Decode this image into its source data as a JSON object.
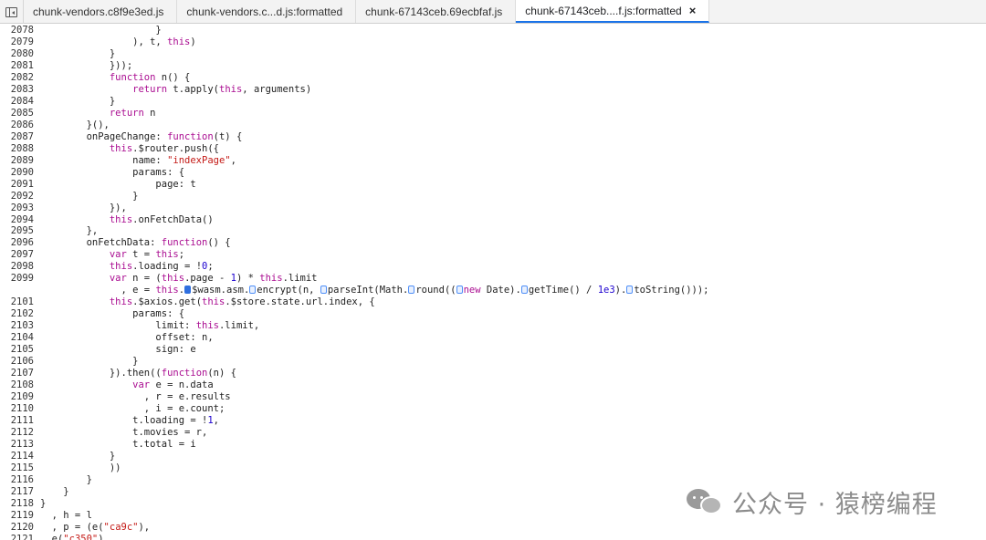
{
  "tabs": [
    {
      "label": "chunk-vendors.c8f9e3ed.js",
      "active": false
    },
    {
      "label": "chunk-vendors.c...d.js:formatted",
      "active": false
    },
    {
      "label": "chunk-67143ceb.69ecbfaf.js",
      "active": false
    },
    {
      "label": "chunk-67143ceb....f.js:formatted",
      "active": true
    }
  ],
  "close_glyph": "×",
  "current_line": "2100",
  "lines": [
    {
      "n": "2078",
      "html": "                    }"
    },
    {
      "n": "2079",
      "html": "                ), t, <span class='kw'>this</span>)"
    },
    {
      "n": "2080",
      "html": "            }"
    },
    {
      "n": "2081",
      "html": "            }));"
    },
    {
      "n": "2082",
      "html": "            <span class='kw'>function</span> n() {"
    },
    {
      "n": "2083",
      "html": "                <span class='kw'>return</span> t.apply(<span class='kw'>this</span>, arguments)"
    },
    {
      "n": "2084",
      "html": "            }"
    },
    {
      "n": "2085",
      "html": "            <span class='kw'>return</span> n"
    },
    {
      "n": "2086",
      "html": "        }(),"
    },
    {
      "n": "2087",
      "html": "        onPageChange: <span class='kw'>function</span>(t) {"
    },
    {
      "n": "2088",
      "html": "            <span class='kw'>this</span>.$router.push({"
    },
    {
      "n": "2089",
      "html": "                name: <span class='str'>\"indexPage\"</span>,"
    },
    {
      "n": "2090",
      "html": "                params: {"
    },
    {
      "n": "2091",
      "html": "                    page: t"
    },
    {
      "n": "2092",
      "html": "                }"
    },
    {
      "n": "2093",
      "html": "            }),"
    },
    {
      "n": "2094",
      "html": "            <span class='kw'>this</span>.onFetchData()"
    },
    {
      "n": "2095",
      "html": "        },"
    },
    {
      "n": "2096",
      "html": "        onFetchData: <span class='kw'>function</span>() {"
    },
    {
      "n": "2097",
      "html": "            <span class='kw'>var</span> t = <span class='kw'>this</span>;"
    },
    {
      "n": "2098",
      "html": "            <span class='kw'>this</span>.loading = !<span class='num'>0</span>;"
    },
    {
      "n": "2099",
      "html": "            <span class='kw'>var</span> n = (<span class='kw'>this</span>.page - <span class='num'>1</span>) * <span class='kw'>this</span>.limit"
    },
    {
      "n": "2100",
      "html": "              , e = <span class='kw'>this</span>.<span class='mark filled'></span>$wasm.asm.<span class='mark'></span>encrypt(n, <span class='mark'></span>parseInt(Math.<span class='mark'></span>round((<span class='mark'></span><span class='kw'>new</span> Date).<span class='mark'></span>getTime() / <span class='num'>1e3</span>).<span class='mark'></span>toString()));"
    },
    {
      "n": "2101",
      "html": "            <span class='kw'>this</span>.$axios.get(<span class='kw'>this</span>.$store.state.url.index, {"
    },
    {
      "n": "2102",
      "html": "                params: {"
    },
    {
      "n": "2103",
      "html": "                    limit: <span class='kw'>this</span>.limit,"
    },
    {
      "n": "2104",
      "html": "                    offset: n,"
    },
    {
      "n": "2105",
      "html": "                    sign: e"
    },
    {
      "n": "2106",
      "html": "                }"
    },
    {
      "n": "2107",
      "html": "            }).then((<span class='kw'>function</span>(n) {"
    },
    {
      "n": "2108",
      "html": "                <span class='kw'>var</span> e = n.data"
    },
    {
      "n": "2109",
      "html": "                  , r = e.results"
    },
    {
      "n": "2110",
      "html": "                  , i = e.count;"
    },
    {
      "n": "2111",
      "html": "                t.loading = !<span class='num'>1</span>,"
    },
    {
      "n": "2112",
      "html": "                t.movies = r,"
    },
    {
      "n": "2113",
      "html": "                t.total = i"
    },
    {
      "n": "2114",
      "html": "            }"
    },
    {
      "n": "2115",
      "html": "            ))"
    },
    {
      "n": "2116",
      "html": "        }"
    },
    {
      "n": "2117",
      "html": "    }"
    },
    {
      "n": "2118",
      "html": "}"
    },
    {
      "n": "2119",
      "html": "  , h = l"
    },
    {
      "n": "2120",
      "html": "  , p = (e(<span class='str'>\"ca9c\"</span>),"
    },
    {
      "n": "2121",
      "html": "  e(<span class='str'>\"c350\"</span>)"
    }
  ],
  "watermark": {
    "text": "公众号 · 猿榜编程"
  }
}
